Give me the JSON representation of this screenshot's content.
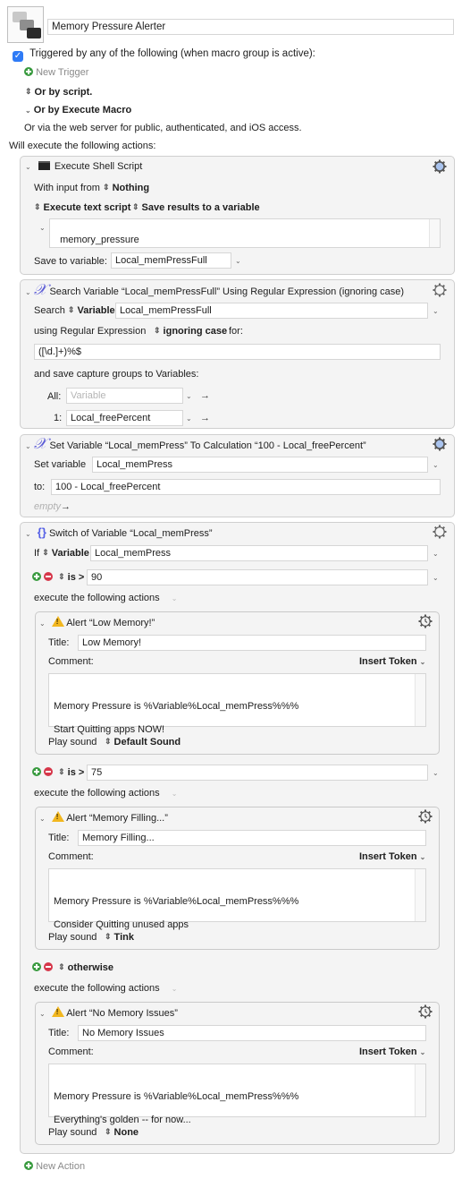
{
  "macro": {
    "name": "Memory Pressure Alerter",
    "icon": "macro-group-icon",
    "trigger_checkbox_checked": true,
    "trigger_label": "Triggered by any of the following (when macro group is active):",
    "new_trigger_label": "New Trigger",
    "or_by_script_label": "Or by script.",
    "or_by_execute_macro_label": "Or by Execute Macro",
    "web_server_label": "Or via the web server for public, authenticated, and iOS access.",
    "will_execute_label": "Will execute the following actions:",
    "new_action_label": "New Action"
  },
  "shell_action": {
    "title": "Execute Shell Script",
    "icon": "terminal-icon",
    "with_input_label": "With input from",
    "input_value": "Nothing",
    "execute_mode": "Execute text script",
    "save_mode": "Save results to a variable",
    "script": "memory_pressure",
    "save_to_label": "Save to variable:",
    "save_to_value": "Local_memPressFull"
  },
  "search_action": {
    "title": "Search Variable “Local_memPressFull” Using Regular Expression (ignoring case)",
    "icon": "variable-x-icon",
    "search_label": "Search",
    "search_source": "Variable",
    "search_value": "Local_memPressFull",
    "using_label": "using Regular Expression",
    "case_mode": "ignoring case",
    "for_label": "for:",
    "regex": "([\\d.]+)%$",
    "capture_label": "and save capture groups to Variables:",
    "all_label": "All:",
    "all_placeholder": "Variable",
    "group1_label": "1:",
    "group1_value": "Local_freePercent"
  },
  "set_action": {
    "title": "Set Variable “Local_memPress” To Calculation “100 - Local_freePercent”",
    "icon": "variable-x-icon",
    "set_label": "Set variable",
    "set_value": "Local_memPress",
    "to_label": "to:",
    "to_value": "100 - Local_freePercent",
    "empty_label": "empty"
  },
  "switch_action": {
    "title": "Switch of Variable “Local_memPress”",
    "icon": "braces-icon",
    "if_label": "If",
    "if_source": "Variable",
    "if_value": "Local_memPress",
    "execute_label": "execute the following actions",
    "cases": [
      {
        "operator": "is >",
        "value": "90",
        "alert": {
          "header": "Alert “Low Memory!”",
          "title_label": "Title:",
          "title_value": "Low Memory!",
          "comment_label": "Comment:",
          "insert_token_label": "Insert Token",
          "comment_line1": "Memory Pressure is %Variable%Local_memPress%%%",
          "comment_line2": "Start Quitting apps NOW!",
          "sound_label": "Play sound",
          "sound_value": "Default Sound"
        }
      },
      {
        "operator": "is >",
        "value": "75",
        "alert": {
          "header": "Alert “Memory Filling...”",
          "title_label": "Title:",
          "title_value": "Memory Filling...",
          "comment_label": "Comment:",
          "insert_token_label": "Insert Token",
          "comment_line1": "Memory Pressure is %Variable%Local_memPress%%%",
          "comment_line2": "Consider Quitting unused apps",
          "sound_label": "Play sound",
          "sound_value": "Tink"
        }
      },
      {
        "operator": "otherwise",
        "value": "",
        "alert": {
          "header": "Alert “No Memory Issues”",
          "title_label": "Title:",
          "title_value": "No Memory Issues",
          "comment_label": "Comment:",
          "insert_token_label": "Insert Token",
          "comment_line1": "Memory Pressure is %Variable%Local_memPress%%%",
          "comment_line2": "Everything's golden -- for now...",
          "sound_label": "Play sound",
          "sound_value": "None"
        }
      }
    ]
  },
  "colors": {
    "checkbox": "#2f7bf6",
    "add_green": "#3a9b40",
    "remove_red": "#d6374a",
    "variable_icon": "#5b5bd6",
    "warning": "#f2b71f"
  }
}
